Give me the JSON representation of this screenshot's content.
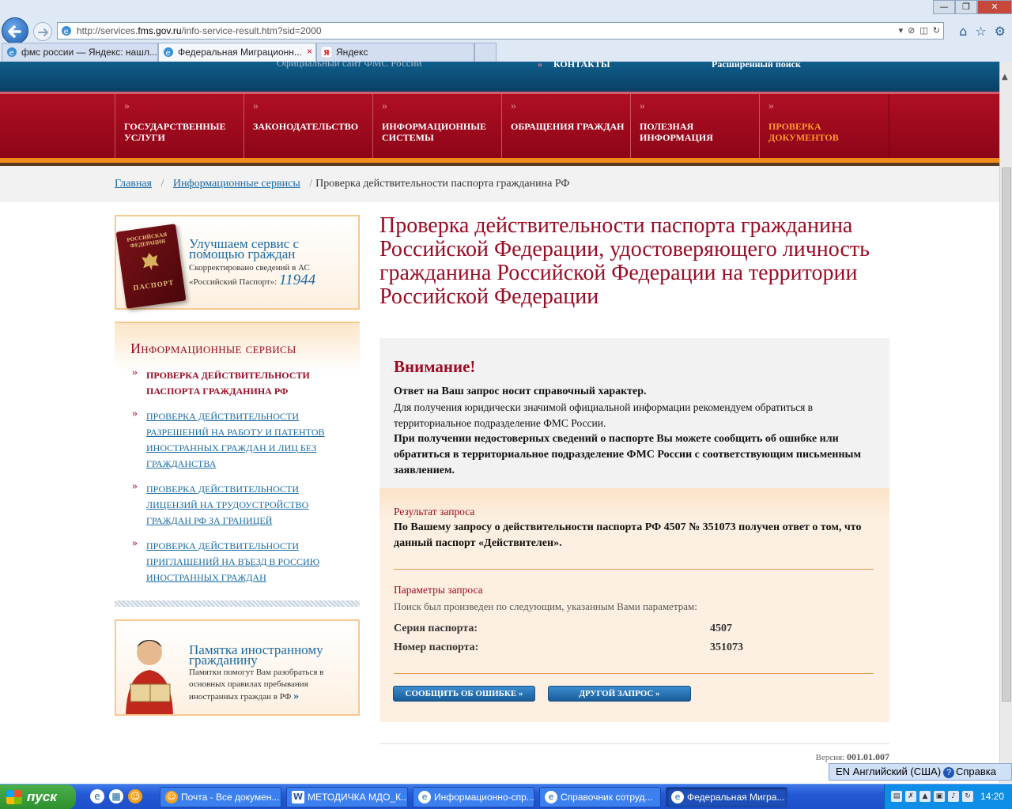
{
  "browser": {
    "url_prefix": "http://services.",
    "url_domain": "fms.gov.ru",
    "url_suffix": "/info-service-result.htm?sid=2000",
    "tabs": [
      {
        "label": "фмс россии — Яндекс: нашл...",
        "icon": "ie-icon",
        "active": false
      },
      {
        "label": "Федеральная Миграционн...",
        "icon": "ie-icon",
        "active": true
      },
      {
        "label": "Яндекс",
        "icon": "yandex-icon",
        "active": false
      }
    ],
    "tab_close": "×"
  },
  "header": {
    "ghost_left": "Официальный сайт ФМС России",
    "ghost_contacts": "КОНТАКТЫ",
    "ghost_search": "Расширенный поиск",
    "menu_raquo": "»",
    "menu": [
      {
        "label": "Государственные услуги",
        "active": false
      },
      {
        "label": "Законодательство",
        "active": false
      },
      {
        "label": "Информационные системы",
        "active": false
      },
      {
        "label": "Обращения граждан",
        "active": false
      },
      {
        "label": "Полезная информация",
        "active": false
      },
      {
        "label": "Проверка документов",
        "active": true
      }
    ]
  },
  "breadcrumb": {
    "home": "Главная",
    "sep": "/",
    "services": "Информационные сервисы",
    "current": "Проверка действительности паспорта гражданина РФ"
  },
  "sidebar": {
    "promo1": {
      "title": "Улучшаем сервис с помощью граждан",
      "text": "Скорректировано сведений в АС «Российский Паспорт»:",
      "number": "11944",
      "image_top": "РОССИЙСКАЯ ФЕДЕРАЦИЯ",
      "image_bottom": "ПАСПОРТ"
    },
    "services_title": "Информационные сервисы",
    "bullet": "»",
    "services": [
      {
        "label": "Проверка действительности паспорта гражданина РФ",
        "current": true
      },
      {
        "label": "Проверка действительности разрешений на работу и патентов иностранных граждан и лиц без гражданства",
        "current": false
      },
      {
        "label": "Проверка действительности лицензий на трудоустройство граждан РФ за границей",
        "current": false
      },
      {
        "label": "Проверка действительности приглашений на въезд в Россию иностранных граждан",
        "current": false
      }
    ],
    "promo2": {
      "title": "Памятка иностранному гражданину",
      "text": "Памятки помогут Вам разобраться в основных правилах пребывания иностранных граждан в РФ",
      "arrow": "»"
    }
  },
  "main": {
    "title": "Проверка действительности паспорта гражданина Российской Федерации, удостоверяющего личность гражданина Российской Федерации на территории Российской Федерации",
    "notice": {
      "title": "Внимание!",
      "line1": "Ответ на Ваш запрос носит справочный характер.",
      "line2": "Для получения юридически значимой официальной информации рекомендуем обратиться в территориальное подразделение ФМС России.",
      "line3": "При получении недостоверных сведений о паспорте Вы можете сообщить об ошибке или обратиться в территориальное подразделение ФМС России с соответствующим письменным заявлением."
    },
    "result": {
      "label": "Результат запроса",
      "text": "По Вашему запросу о действительности паспорта РФ 4507 № 351073 получен ответ о том, что данный паспорт «Действителен»."
    },
    "params": {
      "label": "Параметры запроса",
      "intro": "Поиск был произведен по следующим, указанным Вами параметрам:",
      "rows": [
        {
          "name": "Серия паспорта:",
          "value": "4507"
        },
        {
          "name": "Номер паспорта:",
          "value": "351073"
        }
      ]
    },
    "buttons": {
      "report": "Сообщить об ошибке »",
      "another": "Другой запрос »"
    },
    "version_label": "Версия:",
    "version_value": "001.01.007"
  },
  "taskbar": {
    "start": "пуск",
    "lang": "EN Английский (США)",
    "help": "Справка",
    "help_icon": "?",
    "items": [
      {
        "label": "Почта - Все докумен...",
        "icon": "mail-icon",
        "active": false
      },
      {
        "label": "МЕТОДИЧКА МДО_К...",
        "icon": "word-icon",
        "active": false
      },
      {
        "label": "Информационно-спр...",
        "icon": "ie-icon",
        "active": false
      },
      {
        "label": "Справочник сотруд...",
        "icon": "ie-icon",
        "active": false
      },
      {
        "label": "Федеральная Мигра...",
        "icon": "ie-icon",
        "active": true
      }
    ],
    "clock": "14:20"
  }
}
